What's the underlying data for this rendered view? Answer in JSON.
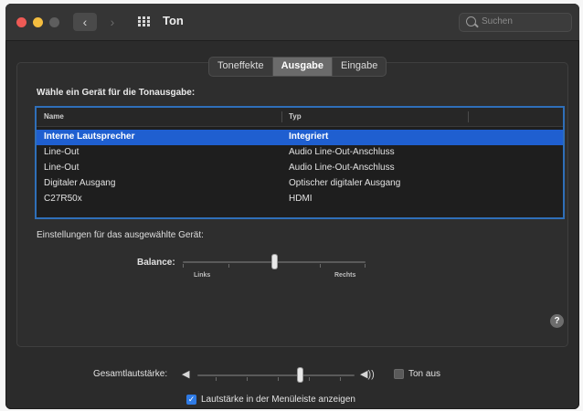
{
  "window": {
    "title": "Ton",
    "nav_back": "‹",
    "nav_forward": "›",
    "search_placeholder": "Suchen"
  },
  "tabs": [
    {
      "label": "Toneffekte",
      "active": false
    },
    {
      "label": "Ausgabe",
      "active": true
    },
    {
      "label": "Eingabe",
      "active": false
    }
  ],
  "output": {
    "heading": "Wähle ein Gerät für die Tonausgabe:",
    "columns": [
      "Name",
      "Typ"
    ],
    "rows": [
      {
        "name": "Interne Lautsprecher",
        "type": "Integriert",
        "selected": true
      },
      {
        "name": "Line-Out",
        "type": "Audio Line-Out-Anschluss",
        "selected": false
      },
      {
        "name": "Line-Out",
        "type": "Audio Line-Out-Anschluss",
        "selected": false
      },
      {
        "name": "Digitaler Ausgang",
        "type": "Optischer digitaler Ausgang",
        "selected": false
      },
      {
        "name": "C27R50x",
        "type": "HDMI",
        "selected": false
      }
    ]
  },
  "device_settings": {
    "label": "Einstellungen für das ausgewählte Gerät:",
    "balance_label": "Balance:",
    "left_label": "Links",
    "right_label": "Rechts",
    "balance_value": 0.5
  },
  "help": "?",
  "volume": {
    "label": "Gesamtlautstärke:",
    "level": 0.65,
    "mute_label": "Ton aus",
    "mute_checked": false,
    "menubar_label": "Lautstärke in der Menüleiste anzeigen",
    "menubar_checked": true,
    "speaker_low": "◀",
    "speaker_high": "◀))"
  }
}
